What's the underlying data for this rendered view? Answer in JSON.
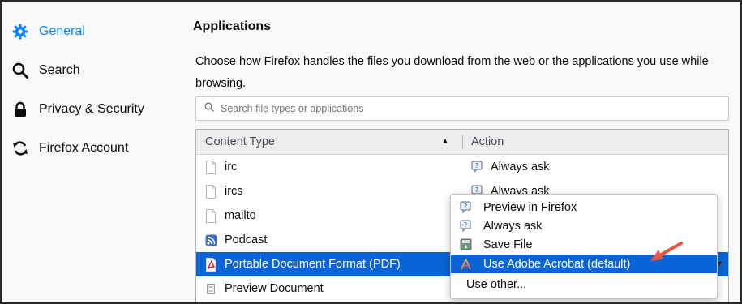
{
  "sidebar": {
    "items": [
      {
        "label": "General",
        "icon": "gear-icon",
        "active": true
      },
      {
        "label": "Search",
        "icon": "search-icon"
      },
      {
        "label": "Privacy & Security",
        "icon": "lock-icon"
      },
      {
        "label": "Firefox Account",
        "icon": "sync-icon"
      }
    ]
  },
  "applications": {
    "title": "Applications",
    "description": "Choose how Firefox handles the files you download from the web or the applications you use while browsing.",
    "search_placeholder": "Search file types or applications",
    "columns": {
      "content_type": "Content Type",
      "action": "Action"
    },
    "rows": [
      {
        "type": "irc",
        "action": "Always ask",
        "icon": "file-icon",
        "action_icon": "ask-icon"
      },
      {
        "type": "ircs",
        "action": "Always ask",
        "icon": "file-icon",
        "action_icon": "ask-icon"
      },
      {
        "type": "mailto",
        "action": "",
        "icon": "file-icon"
      },
      {
        "type": "Podcast",
        "action": "",
        "icon": "rss-icon"
      },
      {
        "type": "Portable Document Format (PDF)",
        "action": "",
        "icon": "pdf-icon",
        "selected": true
      },
      {
        "type": "Preview Document",
        "action": "",
        "icon": "document-icon"
      }
    ]
  },
  "action_menu": {
    "items": [
      {
        "label": "Preview in Firefox",
        "icon": "ask-icon"
      },
      {
        "label": "Always ask",
        "icon": "ask-icon"
      },
      {
        "label": "Save File",
        "icon": "save-file-icon"
      },
      {
        "label": "Use Adobe Acrobat (default)",
        "icon": "acrobat-icon",
        "highlighted": true
      },
      {
        "label": "Use other..."
      }
    ]
  },
  "colors": {
    "accent": "#0a84ff",
    "selection": "#0a64d6",
    "annotation_arrow": "#e8563f"
  }
}
